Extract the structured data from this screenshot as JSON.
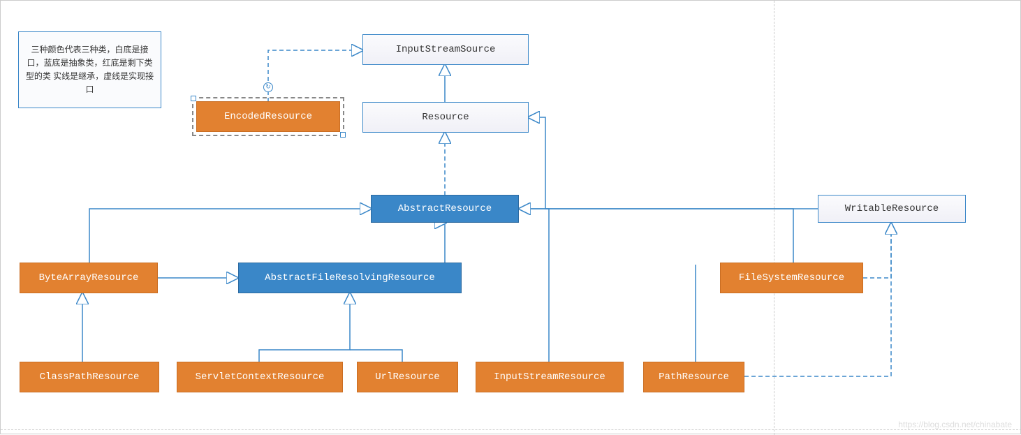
{
  "legend": {
    "text": "三种颜色代表三种类，白底是接口，蓝底是抽象类，红底是剩下类型的类 实线是继承，虚线是实现接口"
  },
  "nodes": {
    "InputStreamSource": "InputStreamSource",
    "Resource": "Resource",
    "EncodedResource": "EncodedResource",
    "AbstractResource": "AbstractResource",
    "WritableResource": "WritableResource",
    "ByteArrayResource": "ByteArrayResource",
    "AbstractFileResolvingResource": "AbstractFileResolvingResource",
    "FileSystemResource": "FileSystemResource",
    "ClassPathResource": "ClassPathResource",
    "ServletContextResource": "ServletContextResource",
    "UrlResource": "UrlResource",
    "InputStreamResource": "InputStreamResource",
    "PathResource": "PathResource"
  },
  "watermark": "https://blog.csdn.net/chinabate",
  "diagram_structure": {
    "interfaces": [
      "InputStreamSource",
      "Resource",
      "WritableResource"
    ],
    "abstract_classes": [
      "AbstractResource",
      "AbstractFileResolvingResource"
    ],
    "concrete_classes": [
      "EncodedResource",
      "ByteArrayResource",
      "FileSystemResource",
      "ClassPathResource",
      "ServletContextResource",
      "UrlResource",
      "InputStreamResource",
      "PathResource"
    ],
    "extends": [
      [
        "Resource",
        "InputStreamSource"
      ],
      [
        "WritableResource",
        "Resource"
      ],
      [
        "ByteArrayResource",
        "AbstractResource"
      ],
      [
        "AbstractFileResolvingResource",
        "AbstractResource"
      ],
      [
        "InputStreamResource",
        "AbstractResource"
      ],
      [
        "FileSystemResource",
        "AbstractResource"
      ],
      [
        "ClassPathResource",
        "ByteArrayResource"
      ],
      [
        "ClassPathResource",
        "AbstractFileResolvingResource"
      ],
      [
        "ServletContextResource",
        "AbstractFileResolvingResource"
      ],
      [
        "UrlResource",
        "AbstractFileResolvingResource"
      ],
      [
        "PathResource",
        "AbstractResource"
      ]
    ],
    "implements": [
      [
        "EncodedResource",
        "InputStreamSource"
      ],
      [
        "AbstractResource",
        "Resource"
      ],
      [
        "FileSystemResource",
        "WritableResource"
      ],
      [
        "PathResource",
        "WritableResource"
      ]
    ]
  }
}
